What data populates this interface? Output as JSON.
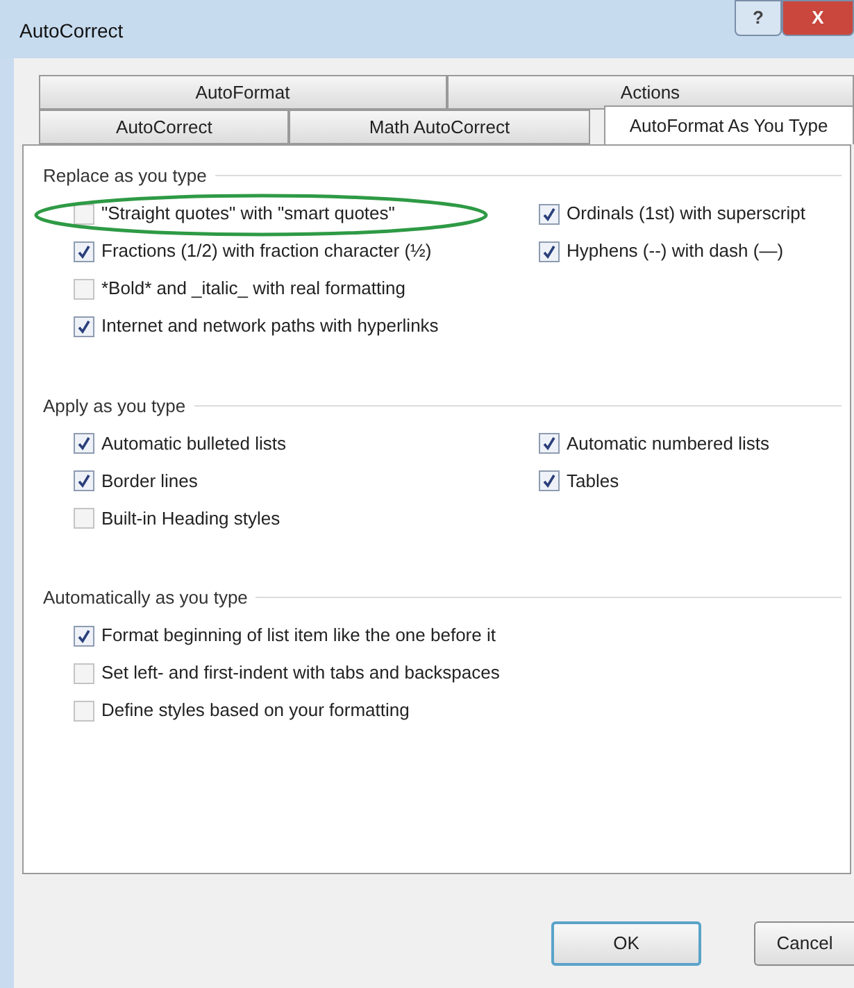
{
  "window": {
    "title": "AutoCorrect",
    "buttons": [
      {
        "kind": "help",
        "label": "?"
      },
      {
        "kind": "close",
        "label": "X"
      }
    ]
  },
  "tab_rows": [
    [
      {
        "label": "AutoFormat",
        "selected": false
      },
      {
        "label": "Actions",
        "selected": false
      }
    ],
    [
      {
        "label": "AutoCorrect",
        "selected": false
      },
      {
        "label": "Math AutoCorrect",
        "selected": false
      },
      {
        "label": "AutoFormat As You Type",
        "selected": true
      }
    ]
  ],
  "sections": [
    {
      "title": "Replace as you type",
      "left": [
        {
          "label": "\"Straight quotes\" with \"smart quotes\"",
          "checked": false,
          "highlighted": true
        },
        {
          "label": "Fractions (1/2) with fraction character (½)",
          "checked": true,
          "highlighted": false
        },
        {
          "label": "*Bold* and _italic_ with real formatting",
          "checked": false,
          "highlighted": false
        },
        {
          "label": "Internet and network paths with hyperlinks",
          "checked": true,
          "highlighted": false
        }
      ],
      "right": [
        {
          "label": "Ordinals (1st) with superscript",
          "checked": true,
          "highlighted": false
        },
        {
          "label": "Hyphens (--) with dash (—)",
          "checked": true,
          "highlighted": false
        }
      ]
    },
    {
      "title": "Apply as you type",
      "left": [
        {
          "label": "Automatic bulleted lists",
          "checked": true,
          "highlighted": false
        },
        {
          "label": "Border lines",
          "checked": true,
          "highlighted": false
        },
        {
          "label": "Built-in Heading styles",
          "checked": false,
          "highlighted": false
        }
      ],
      "right": [
        {
          "label": "Automatic numbered lists",
          "checked": true,
          "highlighted": false
        },
        {
          "label": "Tables",
          "checked": true,
          "highlighted": false
        }
      ]
    },
    {
      "title": "Automatically as you type",
      "left": [
        {
          "label": "Format beginning of list item like the one before it",
          "checked": true,
          "highlighted": false
        },
        {
          "label": "Set left- and first-indent with tabs and backspaces",
          "checked": false,
          "highlighted": false
        },
        {
          "label": "Define styles based on your formatting",
          "checked": false,
          "highlighted": false
        }
      ]
    }
  ],
  "buttons": [
    {
      "label": "OK",
      "default": true
    },
    {
      "label": "Cancel",
      "default": false
    }
  ]
}
